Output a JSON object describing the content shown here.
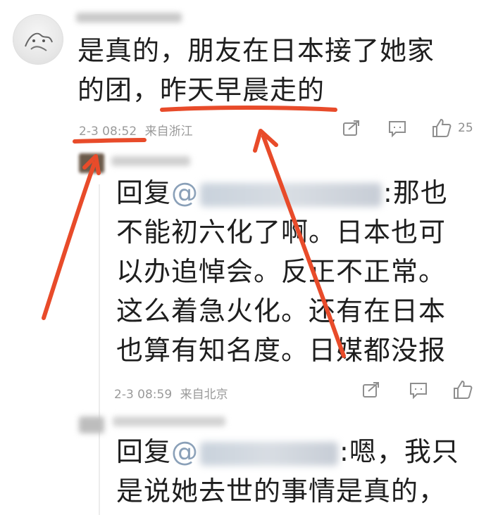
{
  "comment": {
    "text_line1": "是真的，朋友在日本接了她家",
    "text_line2_a": "的团，",
    "text_line2_b": "昨天早晨走的",
    "time": "2-3 08:52",
    "location": "来自浙江",
    "like_count": "25",
    "icons": [
      "share-icon",
      "comment-icon",
      "like-icon"
    ]
  },
  "reply1": {
    "prefix": "回复",
    "mention_hint": "@",
    "line1_after": ":那也",
    "line2": "不能初六化了啊。日本也可",
    "line3": "以办追悼会。反正不正常。",
    "line4": "这么着急火化。还有在日本",
    "line5": "也算有知名度。日媒都没报",
    "time": "2-3 08:59",
    "location": "来自北京",
    "icons": [
      "share-icon",
      "comment-icon",
      "like-icon"
    ]
  },
  "reply2": {
    "prefix": "回复",
    "mention_hint": "@",
    "line1_after": ":嗯，我只",
    "line2": "是说她去世的事情是真的，"
  },
  "annotation_color": "#e84b2a"
}
